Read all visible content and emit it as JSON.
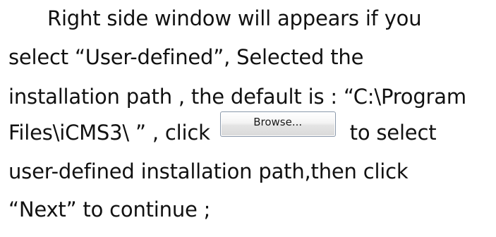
{
  "paragraph": {
    "line1": "Right side window will appears if you",
    "line2": "select “User-defined”, Selected the",
    "line3": "installation path , the default is : “C:\\Program",
    "line4_before": "Files\\iCMS3\\ ” , click",
    "line4_after": "to select",
    "line5": "user-defined installation path,then click",
    "line6": "“Next” to continue ;"
  },
  "browse_button": {
    "label": "Browse..."
  }
}
